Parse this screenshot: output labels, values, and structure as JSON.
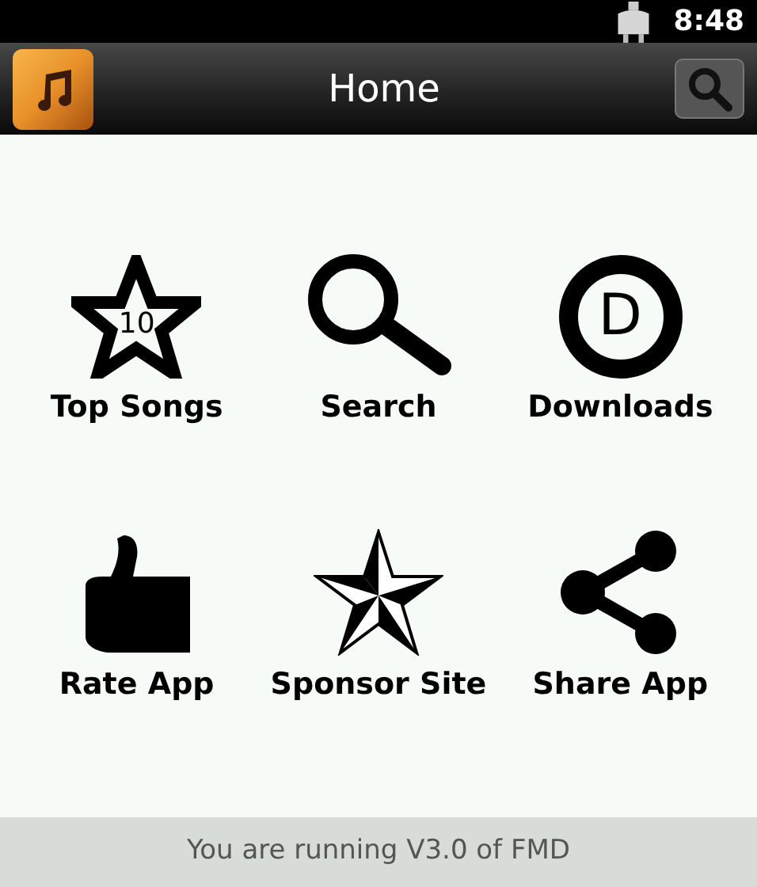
{
  "status_bar": {
    "time": "8:48"
  },
  "action_bar": {
    "title": "Home"
  },
  "menu": [
    {
      "kind": "top",
      "label": "Top Songs",
      "badge": "10"
    },
    {
      "kind": "search",
      "label": "Search"
    },
    {
      "kind": "downloads",
      "label": "Downloads",
      "badge": "D"
    },
    {
      "kind": "rate",
      "label": "Rate App"
    },
    {
      "kind": "sponsor",
      "label": "Sponsor Site"
    },
    {
      "kind": "share",
      "label": "Share App"
    }
  ],
  "footer": {
    "text": "You are running V3.0 of FMD"
  }
}
